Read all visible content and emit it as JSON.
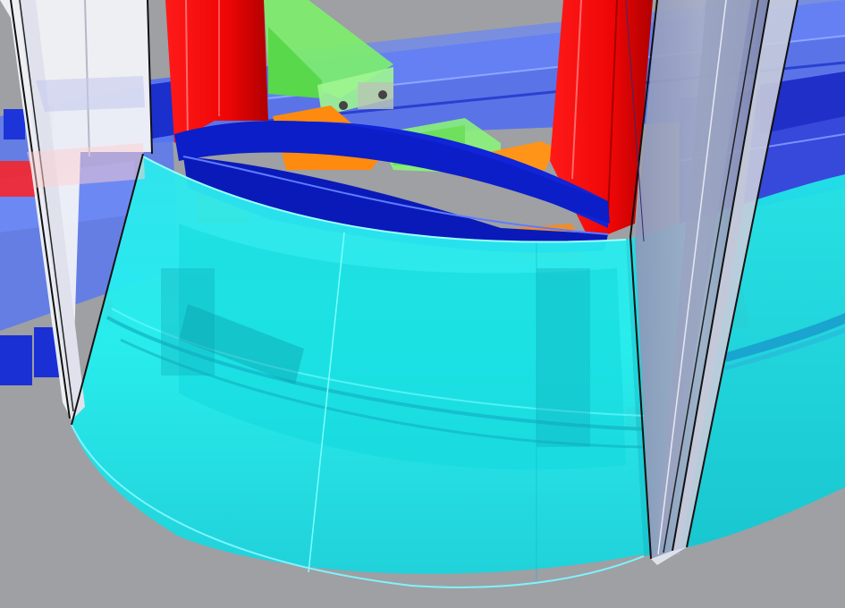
{
  "viewport": {
    "background": "#9ea0a4",
    "description_colors": {
      "glass_panel": "#eef0f4",
      "curved_shell": "#22e8e8",
      "top_ring": "#0a1fd0",
      "vertical_posts": "#ff1010",
      "brackets": "#ff8800",
      "rails_green": "#66ee55",
      "rails_blue": "#3a5cf0"
    }
  }
}
